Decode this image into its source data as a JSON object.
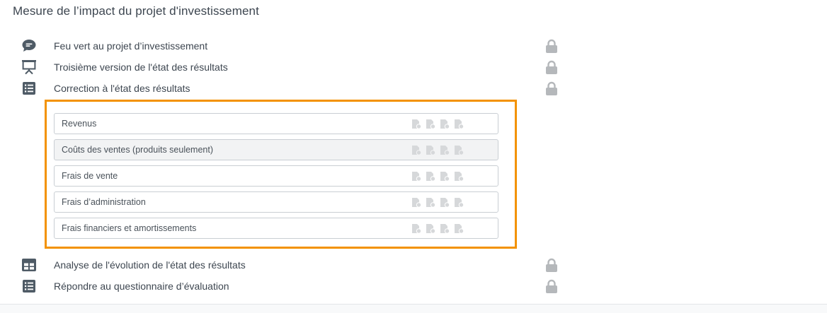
{
  "section": {
    "title": "Mesure de l’impact du projet d'investissement"
  },
  "tasks_top": [
    {
      "label": "Feu vert au projet d’investissement",
      "icon": "chat-bubble-icon",
      "locked": true
    },
    {
      "label": "Troisième version de l'état des résultats",
      "icon": "presentation-board-icon",
      "locked": true
    },
    {
      "label": "Correction à l'état des résultats",
      "icon": "list-document-icon",
      "locked": true
    }
  ],
  "sub_items": [
    {
      "label": "Revenus",
      "active": false
    },
    {
      "label": "Coûts des ventes (produits seulement)",
      "active": true
    },
    {
      "label": "Frais de vente",
      "active": false
    },
    {
      "label": "Frais d’administration",
      "active": false
    },
    {
      "label": "Frais financiers et amortissements",
      "active": false
    }
  ],
  "tasks_bottom": [
    {
      "label": "Analyse de l'évolution de l'état des résultats",
      "icon": "table-grid-icon",
      "locked": true
    },
    {
      "label": "Répondre au questionnaire d’évaluation",
      "icon": "list-document-icon",
      "locked": true
    }
  ],
  "colors": {
    "highlight": "#f39200",
    "icon": "#4f5b66",
    "lock": "#b5b8bb",
    "doc_icon": "#d6d8da"
  }
}
